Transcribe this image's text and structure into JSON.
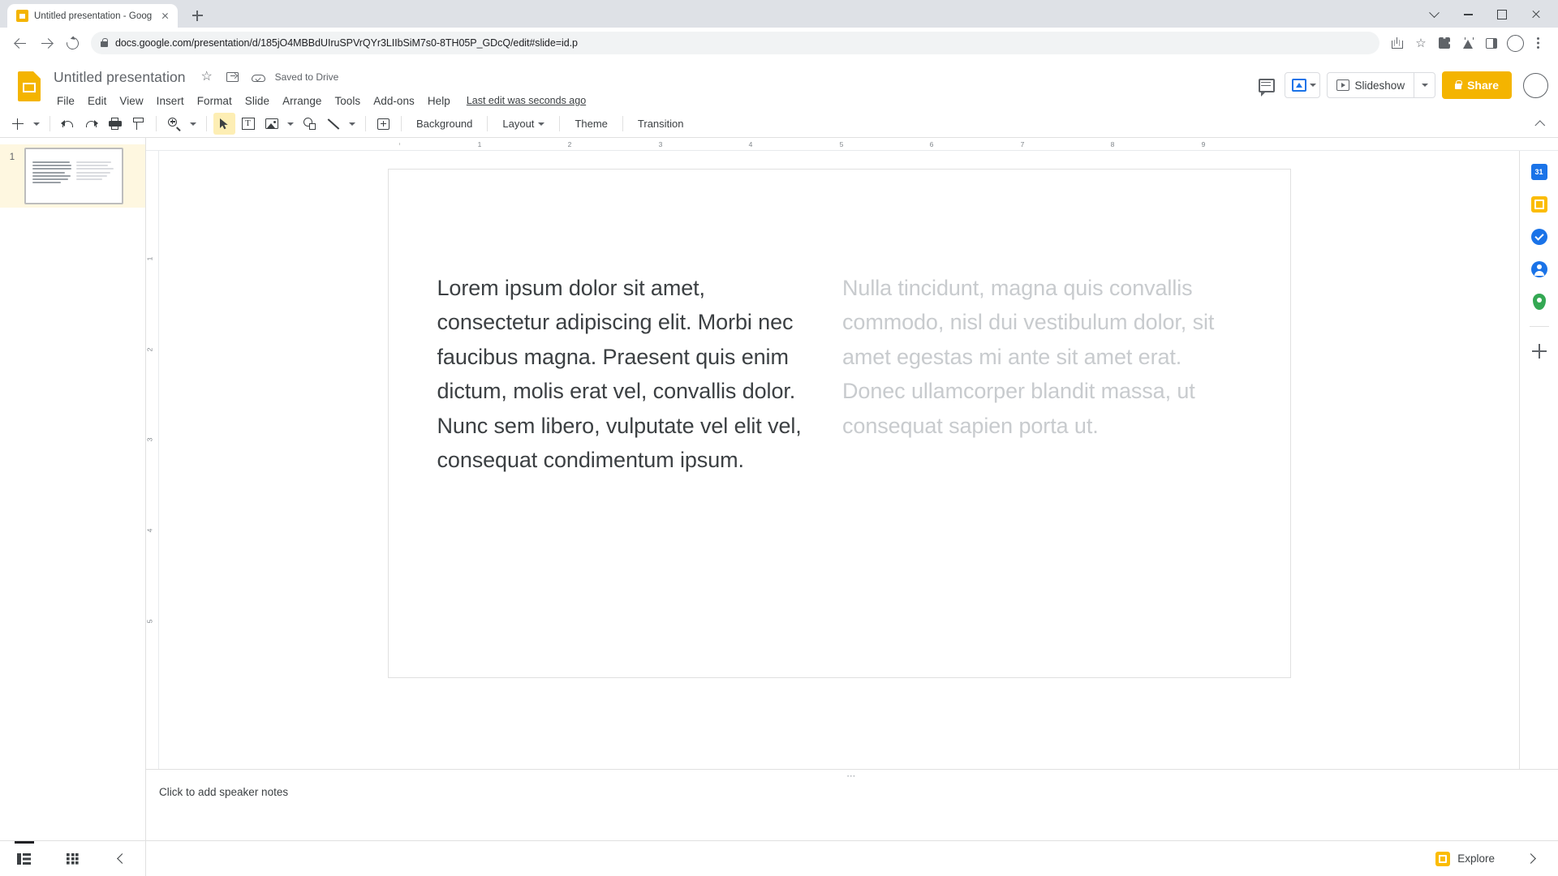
{
  "browser": {
    "tab": {
      "title": "Untitled presentation - Google S",
      "favicon": "slides-favicon"
    },
    "newtab_label": "+",
    "url": "docs.google.com/presentation/d/185jO4MBBdUIruSPVrQYr3LIIbSiM7s0-8TH05P_GDcQ/edit#slide=id.p",
    "window_controls": [
      "minimize",
      "maximize",
      "close"
    ]
  },
  "app": {
    "title": "Untitled presentation",
    "save_status": "Saved to Drive",
    "last_edit": "Last edit was seconds ago",
    "menus": [
      "File",
      "Edit",
      "View",
      "Insert",
      "Format",
      "Slide",
      "Arrange",
      "Tools",
      "Add-ons",
      "Help"
    ],
    "slideshow_label": "Slideshow",
    "share_label": "Share"
  },
  "toolbar": {
    "text_buttons": [
      "Background",
      "Layout",
      "Theme",
      "Transition"
    ],
    "icons": [
      "new-slide",
      "undo",
      "redo",
      "print",
      "paint-format",
      "zoom",
      "select-cursor",
      "text-box",
      "insert-image",
      "insert-shape",
      "insert-line",
      "insert-comment"
    ],
    "active_tool": "select-cursor"
  },
  "filmstrip": {
    "slides": [
      {
        "number": "1",
        "selected": true
      }
    ]
  },
  "ruler": {
    "horizontal_ticks": [
      "1",
      "2",
      "3",
      "4",
      "5",
      "6",
      "7",
      "8",
      "9"
    ],
    "vertical_ticks": [
      "1",
      "2",
      "3",
      "4",
      "5"
    ]
  },
  "slide": {
    "left_text": "Lorem ipsum dolor sit amet, consectetur adipiscing elit. Morbi nec faucibus magna. Praesent quis enim dictum, molis erat vel, convallis dolor. Nunc sem libero, vulputate vel elit vel, consequat condimentum ipsum.",
    "right_text": "Nulla tincidunt, magna quis convallis commodo, nisl dui vestibulum dolor, sit amet egestas mi ante sit amet erat. Donec ullamcorper blandit massa, ut consequat sapien porta ut."
  },
  "notes": {
    "placeholder": "Click to add speaker notes"
  },
  "bottom_bar": {
    "filmstrip_view": "filmstrip-view",
    "grid_view": "grid-view",
    "collapse": "collapse-panel",
    "explore_label": "Explore"
  },
  "right_rail": {
    "items": [
      "calendar",
      "keep",
      "tasks",
      "contacts",
      "maps",
      "add-ons-plus"
    ],
    "calendar_day": "31"
  },
  "colors": {
    "brand_yellow": "#f4b400",
    "accent_blue": "#1a73e8",
    "tool_highlight": "#fdeeb4",
    "selected_row": "#fef7e0",
    "text_primary": "#3c4043",
    "text_secondary": "#5f6368",
    "placeholder_gray": "#c8cbce"
  }
}
